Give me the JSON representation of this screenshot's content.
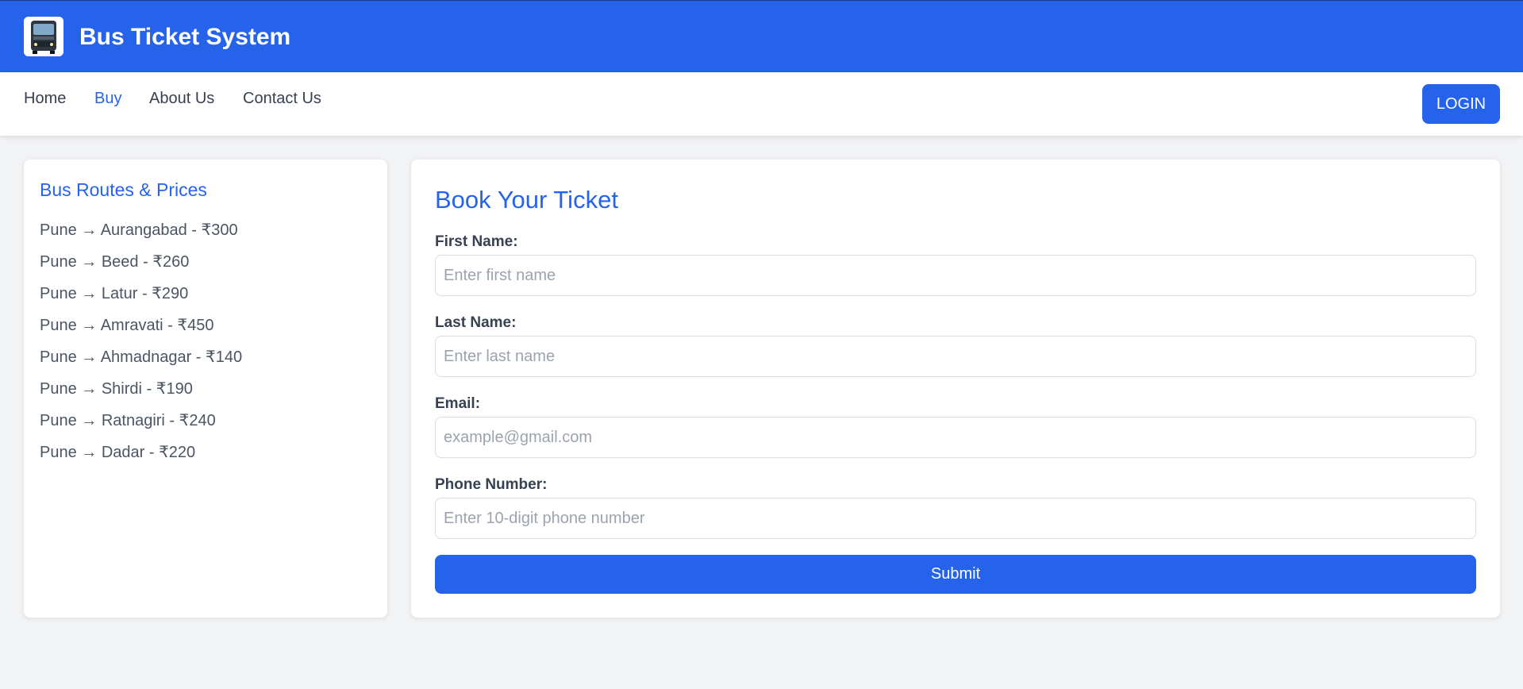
{
  "header": {
    "app_title": "Bus Ticket System",
    "logo_icon": "bus-icon",
    "bg_color": "#2563eb"
  },
  "nav": {
    "items": [
      {
        "label": "Home",
        "active": false
      },
      {
        "label": "Buy",
        "active": true
      },
      {
        "label": "About Us",
        "active": false
      },
      {
        "label": "Contact Us",
        "active": false
      }
    ],
    "login_label": "LOGIN"
  },
  "routes": {
    "title": "Bus Routes & Prices",
    "items": [
      "Pune → Aurangabad - ₹300",
      "Pune → Beed - ₹260",
      "Pune → Latur - ₹290",
      "Pune → Amravati - ₹450",
      "Pune → Ahmadnagar - ₹140",
      "Pune → Shirdi - ₹190",
      "Pune → Ratnagiri - ₹240",
      "Pune → Dadar - ₹220"
    ]
  },
  "form": {
    "title": "Book Your Ticket",
    "first_name": {
      "label": "First Name:",
      "value": "",
      "placeholder": "Enter first name"
    },
    "last_name": {
      "label": "Last Name:",
      "value": "",
      "placeholder": "Enter last name"
    },
    "email": {
      "label": "Email:",
      "value": "",
      "placeholder": "example@gmail.com"
    },
    "phone": {
      "label": "Phone Number:",
      "value": "",
      "placeholder": "Enter 10-digit phone number"
    },
    "submit_label": "Submit"
  },
  "colors": {
    "accent": "#2563eb",
    "page_bg": "#f2f3f5",
    "card_bg": "#ffffff"
  }
}
